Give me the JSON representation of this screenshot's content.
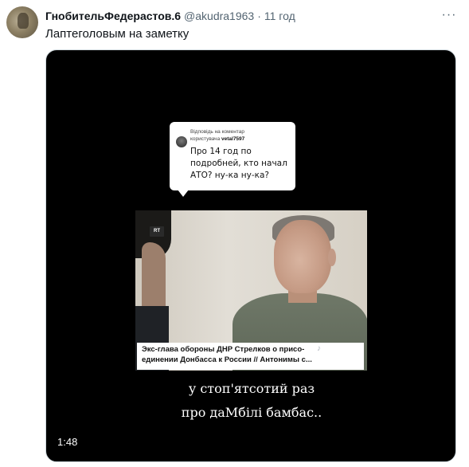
{
  "tweet": {
    "display_name": "ГнобительФедерастов.6",
    "handle": "@akudra1963",
    "separator": "·",
    "time": "11 год",
    "more_icon": "ellipsis-icon",
    "more_label": "···",
    "text": "Лаптеголовым на заметку"
  },
  "video": {
    "reply_bubble": {
      "label": "Відповідь на коментар",
      "user_prefix": "користувача",
      "username": "vetal7597",
      "body": "Про 14 год по\nподробней, кто начал\nАТО? ну-ка ну-ка?"
    },
    "channel_logo": "RT",
    "caption_line_1": "Экс-глава обороны ДНР Стрелков о присо-",
    "caption_line_2": "единении Донбасса к России // Антонимы с...",
    "watermark_icon": "tiktok-icon",
    "subtitle_line_1": "у стоп'ятсотий раз",
    "subtitle_line_2": "про даМбілі бамбас..",
    "duration": "1:48"
  }
}
